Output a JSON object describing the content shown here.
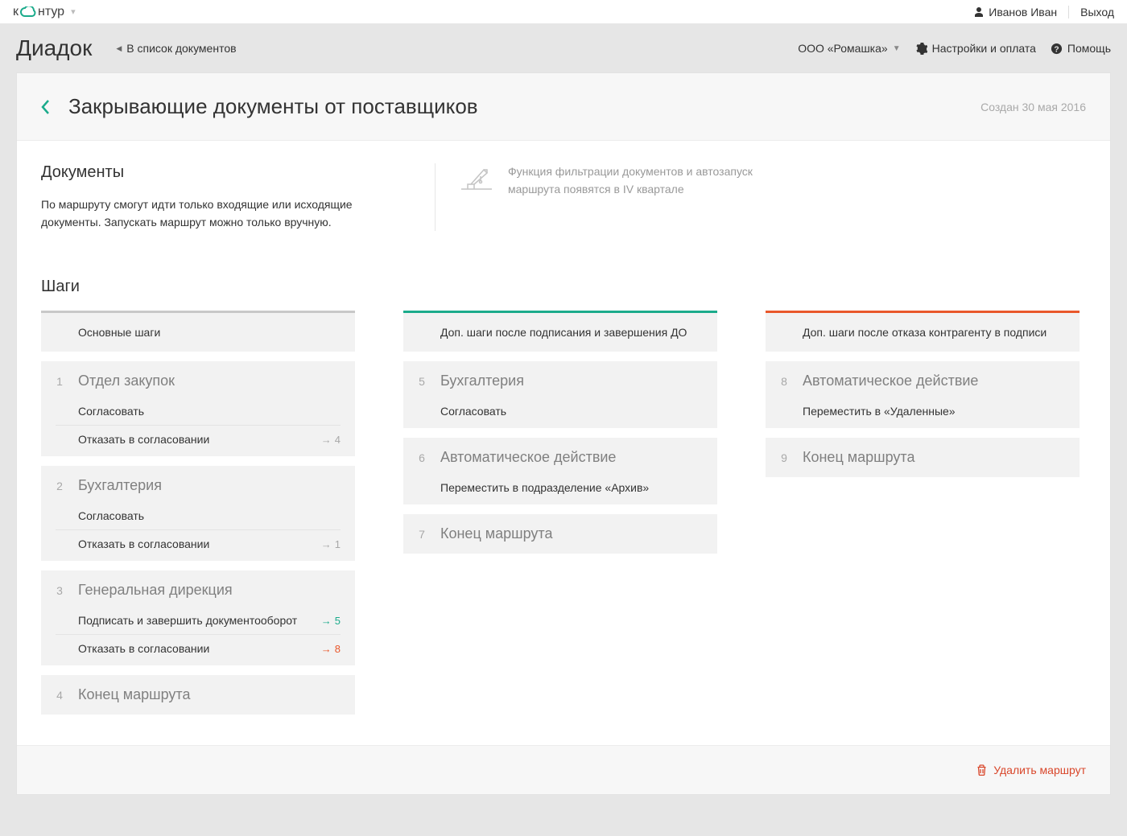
{
  "topbar": {
    "logo_prefix": "к",
    "logo_suffix": "нтур",
    "user_name": "Иванов Иван",
    "logout": "Выход"
  },
  "secondbar": {
    "app_name": "Диадок",
    "back_link": "В список документов",
    "org_name": "ООО «Ромашка»",
    "settings": "Настройки и оплата",
    "help": "Помощь"
  },
  "page": {
    "title": "Закрывающие документы от поставщиков",
    "created": "Создан 30 мая 2016"
  },
  "documents": {
    "heading": "Документы",
    "text": "По маршруту смогут идти только входящие или исходящие документы. Запускать маршрут можно только вручную.",
    "wip_text": "Функция фильтрации документов и автозапуск маршрута появятся в IV квартале"
  },
  "steps": {
    "heading": "Шаги",
    "columns": [
      {
        "header": "Основные шаги",
        "items": [
          {
            "num": "1",
            "title": "Отдел закупок",
            "lines": [
              {
                "text": "Согласовать",
                "goto": ""
              },
              {
                "text": "Отказать в согласовании",
                "goto": "4",
                "color": "gray"
              }
            ]
          },
          {
            "num": "2",
            "title": "Бухгалтерия",
            "lines": [
              {
                "text": "Согласовать",
                "goto": ""
              },
              {
                "text": "Отказать в согласовании",
                "goto": "1",
                "color": "gray"
              }
            ]
          },
          {
            "num": "3",
            "title": "Генеральная дирекция",
            "lines": [
              {
                "text": "Подписать и завершить документооборот",
                "goto": "5",
                "color": "green"
              },
              {
                "text": "Отказать в согласовании",
                "goto": "8",
                "color": "red"
              }
            ]
          },
          {
            "num": "4",
            "title": "Конец маршрута",
            "end": true
          }
        ]
      },
      {
        "header": "Доп. шаги после подписания и завершения ДО",
        "items": [
          {
            "num": "5",
            "title": "Бухгалтерия",
            "lines": [
              {
                "text": "Согласовать",
                "goto": ""
              }
            ]
          },
          {
            "num": "6",
            "title": "Автоматическое действие",
            "lines": [
              {
                "text": "Переместить в подразделение «Архив»",
                "goto": ""
              }
            ]
          },
          {
            "num": "7",
            "title": "Конец маршрута",
            "end": true
          }
        ]
      },
      {
        "header": "Доп. шаги после отказа контрагенту в подписи",
        "items": [
          {
            "num": "8",
            "title": "Автоматическое действие",
            "lines": [
              {
                "text": "Переместить в «Удаленные»",
                "goto": ""
              }
            ]
          },
          {
            "num": "9",
            "title": "Конец маршрута",
            "end": true
          }
        ]
      }
    ]
  },
  "footer": {
    "delete": "Удалить маршрут"
  }
}
